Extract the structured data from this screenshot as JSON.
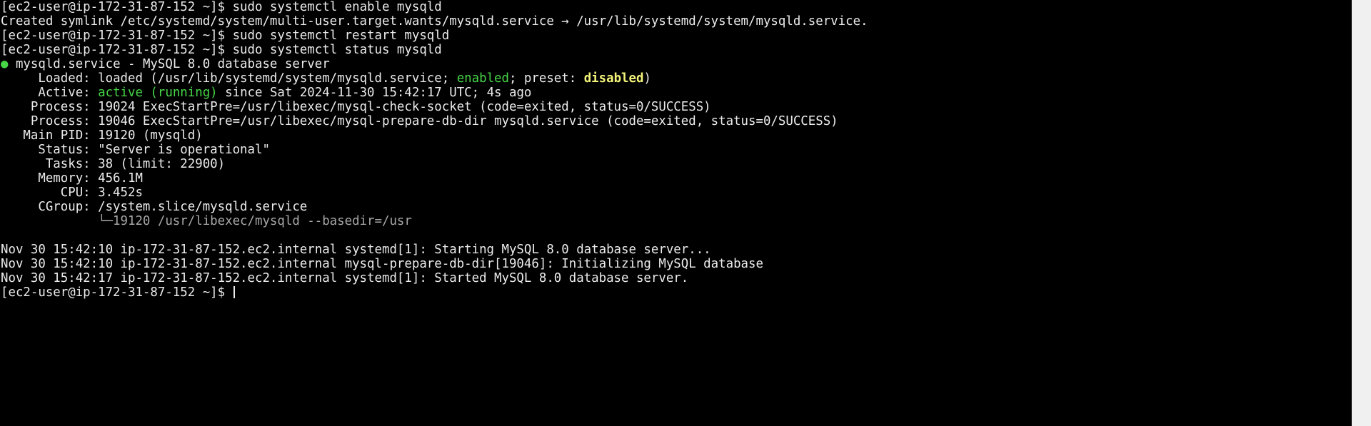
{
  "terminal": {
    "prompt": "[ec2-user@ip-172-31-87-152 ~]$ ",
    "commands": {
      "enable": "sudo systemctl enable mysqld",
      "restart": "sudo systemctl restart mysqld",
      "status": "sudo systemctl status mysqld"
    },
    "symlink_line": "Created symlink /etc/systemd/system/multi-user.target.wants/mysqld.service → /usr/lib/systemd/system/mysqld.service.",
    "status": {
      "bullet": "●",
      "service_line": " mysqld.service - MySQL 8.0 database server",
      "loaded_label": "     Loaded: ",
      "loaded_value_pre": "loaded (/usr/lib/systemd/system/mysqld.service; ",
      "loaded_enabled": "enabled",
      "loaded_mid": "; preset: ",
      "loaded_preset": "disabled",
      "loaded_end": ")",
      "active_label": "     Active: ",
      "active_state": "active (running)",
      "active_since": " since Sat 2024-11-30 15:42:17 UTC; 4s ago",
      "process1": "    Process: 19024 ExecStartPre=/usr/libexec/mysql-check-socket (code=exited, status=0/SUCCESS)",
      "process2": "    Process: 19046 ExecStartPre=/usr/libexec/mysql-prepare-db-dir mysqld.service (code=exited, status=0/SUCCESS)",
      "main_pid": "   Main PID: 19120 (mysqld)",
      "status_text": "     Status: \"Server is operational\"",
      "tasks": "      Tasks: 38 (limit: 22900)",
      "memory": "     Memory: 456.1M",
      "cpu": "        CPU: 3.452s",
      "cgroup": "     CGroup: /system.slice/mysqld.service",
      "cgroup_child": "             └─19120 /usr/libexec/mysqld --basedir=/usr"
    },
    "logs": [
      "Nov 30 15:42:10 ip-172-31-87-152.ec2.internal systemd[1]: Starting MySQL 8.0 database server...",
      "Nov 30 15:42:10 ip-172-31-87-152.ec2.internal mysql-prepare-db-dir[19046]: Initializing MySQL database",
      "Nov 30 15:42:17 ip-172-31-87-152.ec2.internal systemd[1]: Started MySQL 8.0 database server."
    ],
    "colors": {
      "background": "#000000",
      "foreground": "#ebebeb",
      "green": "#46d646",
      "yellow": "#f4f47a",
      "scrollbar": "#f0f0f0"
    }
  }
}
